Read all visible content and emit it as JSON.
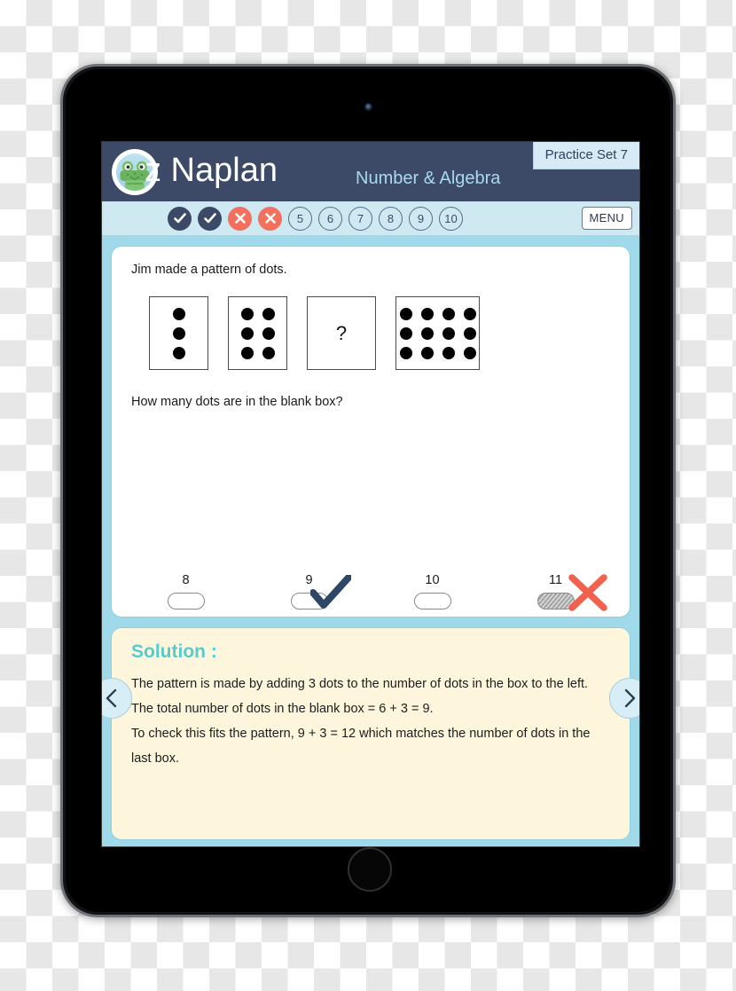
{
  "device": {
    "type": "tablet",
    "camera_icon": "camera-dot",
    "home_button_icon": "home-button-circle"
  },
  "app": {
    "logo_icon": "crocodile-mascot-icon",
    "title": "z Naplan",
    "subtitle": "Number & Algebra",
    "practice_set_badge": "Practice Set 7",
    "menu_label": "MENU"
  },
  "progress": {
    "items": [
      {
        "label": "1",
        "state": "correct",
        "icon": "check-icon"
      },
      {
        "label": "2",
        "state": "correct",
        "icon": "check-icon"
      },
      {
        "label": "3",
        "state": "wrong",
        "icon": "cross-icon"
      },
      {
        "label": "4",
        "state": "wrong",
        "icon": "cross-icon"
      },
      {
        "label": "5",
        "state": "pending",
        "icon": ""
      },
      {
        "label": "6",
        "state": "pending",
        "icon": ""
      },
      {
        "label": "7",
        "state": "pending",
        "icon": ""
      },
      {
        "label": "8",
        "state": "pending",
        "icon": ""
      },
      {
        "label": "9",
        "state": "pending",
        "icon": ""
      },
      {
        "label": "10",
        "state": "pending",
        "icon": ""
      }
    ]
  },
  "question": {
    "intro": "Jim made a pattern of dots.",
    "prompt": "How many dots are in the blank box?",
    "pattern_boxes": [
      {
        "dots": 3,
        "cols": 1,
        "rows": 3,
        "placeholder": ""
      },
      {
        "dots": 6,
        "cols": 2,
        "rows": 3,
        "placeholder": ""
      },
      {
        "dots": 0,
        "cols": 0,
        "rows": 0,
        "placeholder": "?"
      },
      {
        "dots": 12,
        "cols": 4,
        "rows": 3,
        "placeholder": ""
      }
    ]
  },
  "answers": {
    "options": [
      {
        "label": "8",
        "selected": false,
        "mark": ""
      },
      {
        "label": "9",
        "selected": false,
        "mark": "tick"
      },
      {
        "label": "10",
        "selected": false,
        "mark": ""
      },
      {
        "label": "11",
        "selected": true,
        "mark": "cross"
      }
    ]
  },
  "navigation": {
    "prev_icon": "chevron-left-icon",
    "next_icon": "chevron-right-icon"
  },
  "solution": {
    "title": "Solution :",
    "lines": [
      "The pattern is made by adding 3 dots to the number of dots in the box to the left.",
      "The total number of dots in the blank box = 6 + 3 = 9.",
      "To check this fits the pattern, 9 + 3 = 12 which matches the number of dots in the last box."
    ]
  },
  "colors": {
    "header_navy": "#3c4a67",
    "subtitle_blue": "#a9d9ef",
    "page_cyan": "#9fd9ea",
    "progress_bar": "#cfe9f2",
    "correct_navy": "#3c4a67",
    "wrong_coral": "#f4705e",
    "solution_bg": "#fdf6dc",
    "solution_title": "#55cbd0",
    "card_border": "#8ed0e2"
  }
}
